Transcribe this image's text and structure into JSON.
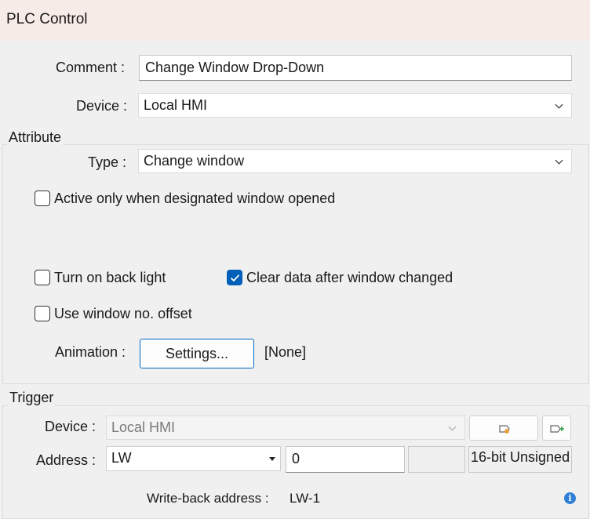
{
  "window": {
    "title": "PLC Control"
  },
  "general": {
    "comment_label": "Comment :",
    "comment_value": "Change Window Drop-Down",
    "device_label": "Device :",
    "device_value": "Local HMI"
  },
  "attribute": {
    "group_label": "Attribute",
    "type_label": "Type :",
    "type_value": "Change window",
    "active_only_label": "Active only when designated window opened",
    "active_only_checked": false,
    "back_light_label": "Turn on back light",
    "back_light_checked": false,
    "clear_data_label": "Clear data after window changed",
    "clear_data_checked": true,
    "offset_label": "Use window no. offset",
    "offset_checked": false,
    "animation_label": "Animation :",
    "settings_button": "Settings...",
    "animation_value": "[None]"
  },
  "trigger": {
    "group_label": "Trigger",
    "device_label": "Device :",
    "device_value": "Local HMI",
    "address_label": "Address :",
    "address_type": "LW",
    "address_value": "0",
    "data_format": "16-bit Unsigned",
    "writeback_label": "Write-back address :",
    "writeback_value": "LW-1"
  },
  "colors": {
    "accent": "#005fb8",
    "titlebar": "#f7ebe7",
    "info": "#2f7fd6"
  }
}
